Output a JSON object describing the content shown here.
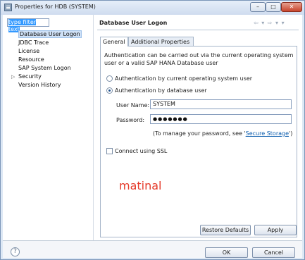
{
  "window": {
    "title": "Properties for HDB (SYSTEM)",
    "min_glyph": "–",
    "max_glyph": "□",
    "close_glyph": "✕"
  },
  "filter": {
    "placeholder": "type filter text"
  },
  "tree": {
    "items": [
      {
        "label": "Database User Logon",
        "selected": true
      },
      {
        "label": "JDBC Trace"
      },
      {
        "label": "License"
      },
      {
        "label": "Resource"
      },
      {
        "label": "SAP System Logon"
      },
      {
        "label": "Security",
        "expandable": true,
        "chevron": "▷"
      },
      {
        "label": "Version History"
      }
    ]
  },
  "page": {
    "title": "Database User Logon",
    "nav_arrows": "⇦ ▾ ⇨ ▾ ▾"
  },
  "tabs": [
    {
      "label": "General",
      "active": true
    },
    {
      "label": "Additional Properties"
    }
  ],
  "general": {
    "description_line1": "Authentication can be carried out via the current operating system",
    "description_line2": "user or a valid SAP HANA Database user",
    "radio_os_user": "Authentication by current operating system user",
    "radio_db_user": "Authentication by database user",
    "user_name_label": "User Name:",
    "user_name_value": "SYSTEM",
    "password_label": "Password:",
    "password_value": "●●●●●●●",
    "hint_prefix": "(To manage your password, see '",
    "hint_link": "Secure Storage",
    "hint_suffix": "')",
    "ssl_label": "Connect using SSL",
    "selected_auth": "database_user",
    "ssl_checked": false
  },
  "watermark": "matinal",
  "buttons": {
    "restore_defaults": "Restore Defaults",
    "apply": "Apply",
    "ok": "OK",
    "cancel": "Cancel",
    "help_glyph": "?"
  }
}
